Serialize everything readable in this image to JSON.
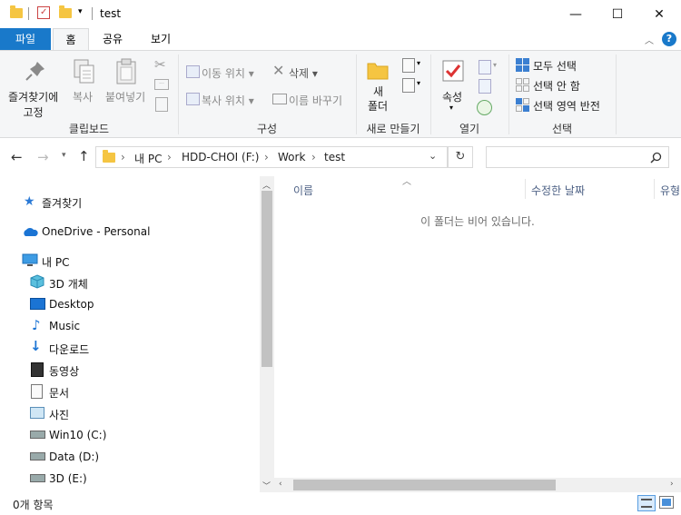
{
  "window": {
    "title": "test",
    "minimize_glyph": "—",
    "maximize_glyph": "☐",
    "close_glyph": "✕"
  },
  "ribbon_tabs": {
    "file": "파일",
    "home": "홈",
    "share": "공유",
    "view": "보기"
  },
  "ribbon": {
    "clipboard": {
      "pin": "즐겨찾기에\n고정",
      "pin_line1": "즐겨찾기에",
      "pin_line2": "고정",
      "copy": "복사",
      "paste": "붙여넣기",
      "label": "클립보드"
    },
    "organize": {
      "move_to": "이동 위치",
      "copy_to": "복사 위치",
      "delete": "삭제",
      "rename": "이름 바꾸기",
      "label": "구성"
    },
    "new": {
      "new_folder_line1": "새",
      "new_folder_line2": "폴더",
      "label": "새로 만들기"
    },
    "open": {
      "properties": "속성",
      "label": "열기"
    },
    "select": {
      "select_all": "모두 선택",
      "select_none": "선택 안 함",
      "invert": "선택 영역 반전",
      "label": "선택"
    }
  },
  "address": {
    "crumbs": [
      "내 PC",
      "HDD-CHOI (F:)",
      "Work",
      "test"
    ],
    "search_placeholder": ""
  },
  "nav_pane": {
    "favorites": "즐겨찾기",
    "onedrive": "OneDrive - Personal",
    "this_pc": "내 PC",
    "items": [
      "3D 개체",
      "Desktop",
      "Music",
      "다운로드",
      "동영상",
      "문서",
      "사진",
      "Win10 (C:)",
      "Data (D:)",
      "3D (E:)"
    ]
  },
  "content": {
    "columns": [
      "이름",
      "수정한 날짜",
      "유형"
    ],
    "empty_message": "이 폴더는 비어 있습니다."
  },
  "status": {
    "item_count": "0개 항목"
  },
  "colors": {
    "accent": "#1979ca",
    "folder": "#f5c542",
    "ribbon_bg": "#f5f6f7"
  }
}
